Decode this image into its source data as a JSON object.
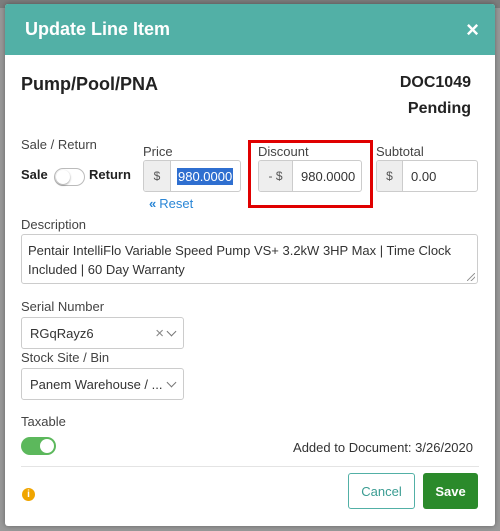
{
  "modal": {
    "title": "Update Line Item",
    "close_glyph": "×"
  },
  "item": {
    "name": "Pump/Pool/PNA",
    "doc_number": "DOC1049",
    "doc_status": "Pending"
  },
  "sale_return": {
    "label": "Sale / Return",
    "sale_label": "Sale",
    "return_label": "Return"
  },
  "price": {
    "label": "Price",
    "addon": "$",
    "value": "980.0000",
    "reset_icon": "«",
    "reset_label": "Reset"
  },
  "discount": {
    "label": "Discount",
    "addon": "- $",
    "value": "980.0000"
  },
  "subtotal": {
    "label": "Subtotal",
    "addon": "$",
    "value": "0.00"
  },
  "description": {
    "label": "Description",
    "value": "Pentair IntelliFlo Variable Speed Pump VS+ 3.2kW 3HP Max | Time Clock Included | 60 Day Warranty"
  },
  "serial": {
    "label": "Serial Number",
    "value": "RGqRayz6",
    "clear_glyph": "×"
  },
  "stock_site": {
    "label": "Stock Site / Bin",
    "value": "Panem Warehouse / ..."
  },
  "taxable": {
    "label": "Taxable",
    "enabled": true
  },
  "added": {
    "text": "Added to Document: 3/26/2020"
  },
  "footer": {
    "info_glyph": "i",
    "cancel_label": "Cancel",
    "save_label": "Save"
  },
  "colors": {
    "header": "#52b0a6",
    "save": "#2b8a2b",
    "highlight": "#e00000",
    "link": "#2a86d6",
    "toggle_on": "#5cb85c",
    "info": "#f0a500"
  }
}
